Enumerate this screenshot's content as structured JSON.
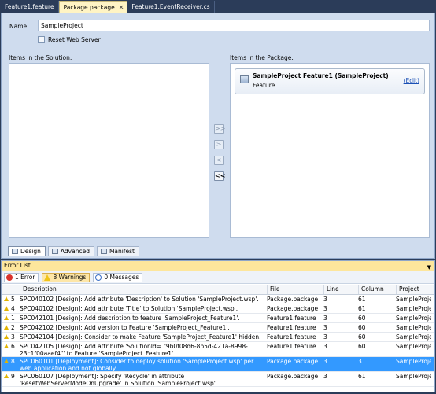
{
  "tabs": [
    "Feature1.feature",
    "Package.package",
    "Feature1.EventReceiver.cs"
  ],
  "designer": {
    "name_label": "Name:",
    "name_value": "SampleProject",
    "reset_label": "Reset Web Server",
    "items_solution_label": "Items in the Solution:",
    "items_package_label": "Items in the Package:",
    "package_item": {
      "title": "SampleProject Feature1 (SampleProject)",
      "type": "Feature",
      "edit": "(Edit)"
    },
    "move_buttons": [
      ">>",
      ">",
      "<",
      "<<"
    ],
    "view_tabs": [
      "Design",
      "Advanced",
      "Manifest"
    ]
  },
  "error_list": {
    "title": "Error List",
    "filters": {
      "errors": "1 Error",
      "warnings": "8 Warnings",
      "messages": "0 Messages"
    },
    "columns": [
      "Description",
      "File",
      "Line",
      "Column",
      "Project"
    ],
    "rows": [
      {
        "num": "5",
        "desc": "SPC040102 [Design]: Add attribute 'Description' to Solution 'SampleProject.wsp'.",
        "file": "Package.package",
        "line": "3",
        "col": "61",
        "project": "SampleProject"
      },
      {
        "num": "4",
        "desc": "SPC040102 [Design]: Add attribute 'Title' to Solution 'SampleProject.wsp'.",
        "file": "Package.package",
        "line": "3",
        "col": "61",
        "project": "SampleProject"
      },
      {
        "num": "1",
        "desc": "SPC042101 [Design]: Add description to feature 'SampleProject_Feature1'.",
        "file": "Feature1.feature",
        "line": "3",
        "col": "60",
        "project": "SampleProject"
      },
      {
        "num": "2",
        "desc": "SPC042102 [Design]: Add version to Feature 'SampleProject_Feature1'.",
        "file": "Feature1.feature",
        "line": "3",
        "col": "60",
        "project": "SampleProject"
      },
      {
        "num": "3",
        "desc": "SPC042104 [Design]: Consider to make Feature 'SampleProject_Feature1' hidden.",
        "file": "Feature1.feature",
        "line": "3",
        "col": "60",
        "project": "SampleProject"
      },
      {
        "num": "6",
        "desc": "SPC042105 [Design]: Add attribute 'SolutionId= \"9b0f08d6-8b5d-421a-8998-23c1f00aaef4\"' to Feature 'SampleProject_Feature1'.",
        "file": "Feature1.feature",
        "line": "3",
        "col": "60",
        "project": "SampleProject"
      },
      {
        "num": "8",
        "desc": "SPC060101 [Deployment]: Consider to deploy solution 'SampleProject.wsp' per web application and not globally.",
        "file": "Package.package",
        "line": "3",
        "col": "3",
        "project": "SampleProject"
      },
      {
        "num": "9",
        "desc": "SPC060107 [Deployment]: Specify 'Recycle' in attribute 'ResetWebServerModeOnUpgrade' in Solution 'SampleProject.wsp'.",
        "file": "Package.package",
        "line": "3",
        "col": "61",
        "project": "SampleProject"
      }
    ]
  },
  "colors": {
    "frame": "#2b3c59",
    "designer_bg": "#cfdcee",
    "selected_row": "#3399ff",
    "error_title_bg": "#fde69c"
  }
}
